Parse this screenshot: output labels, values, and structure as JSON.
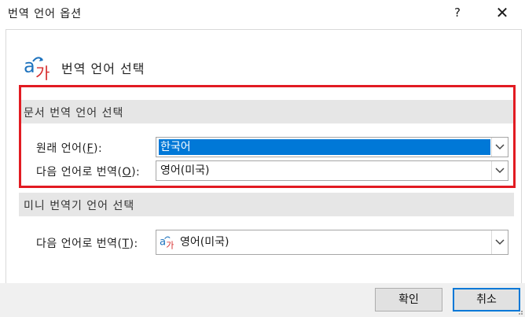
{
  "window": {
    "title": "번역 언어 옵션",
    "help_label": "?",
    "close_label": "✕"
  },
  "heading": {
    "icon": "translate-icon",
    "text": "번역 언어 선택"
  },
  "document_section": {
    "title": "문서 번역 언어 선택",
    "source_label_prefix": "원래 언어(",
    "source_label_key": "F",
    "source_label_suffix": "):",
    "source_value": "한국어",
    "target_label_prefix": "다음 언어로 번역(",
    "target_label_key": "O",
    "target_label_suffix": "):",
    "target_value": "영어(미국)"
  },
  "mini_section": {
    "title": "미니 번역기 언어 선택",
    "target_label_prefix": "다음 언어로 번역(",
    "target_label_key": "T",
    "target_label_suffix": "):",
    "target_value": "영어(미국)",
    "target_icon": "translate-icon"
  },
  "buttons": {
    "ok": "확인",
    "cancel": "취소"
  },
  "colors": {
    "highlight_box": "#e21b22",
    "selection": "#0078d7",
    "icon_blue": "#1e73be",
    "icon_red": "#d62b2b"
  }
}
